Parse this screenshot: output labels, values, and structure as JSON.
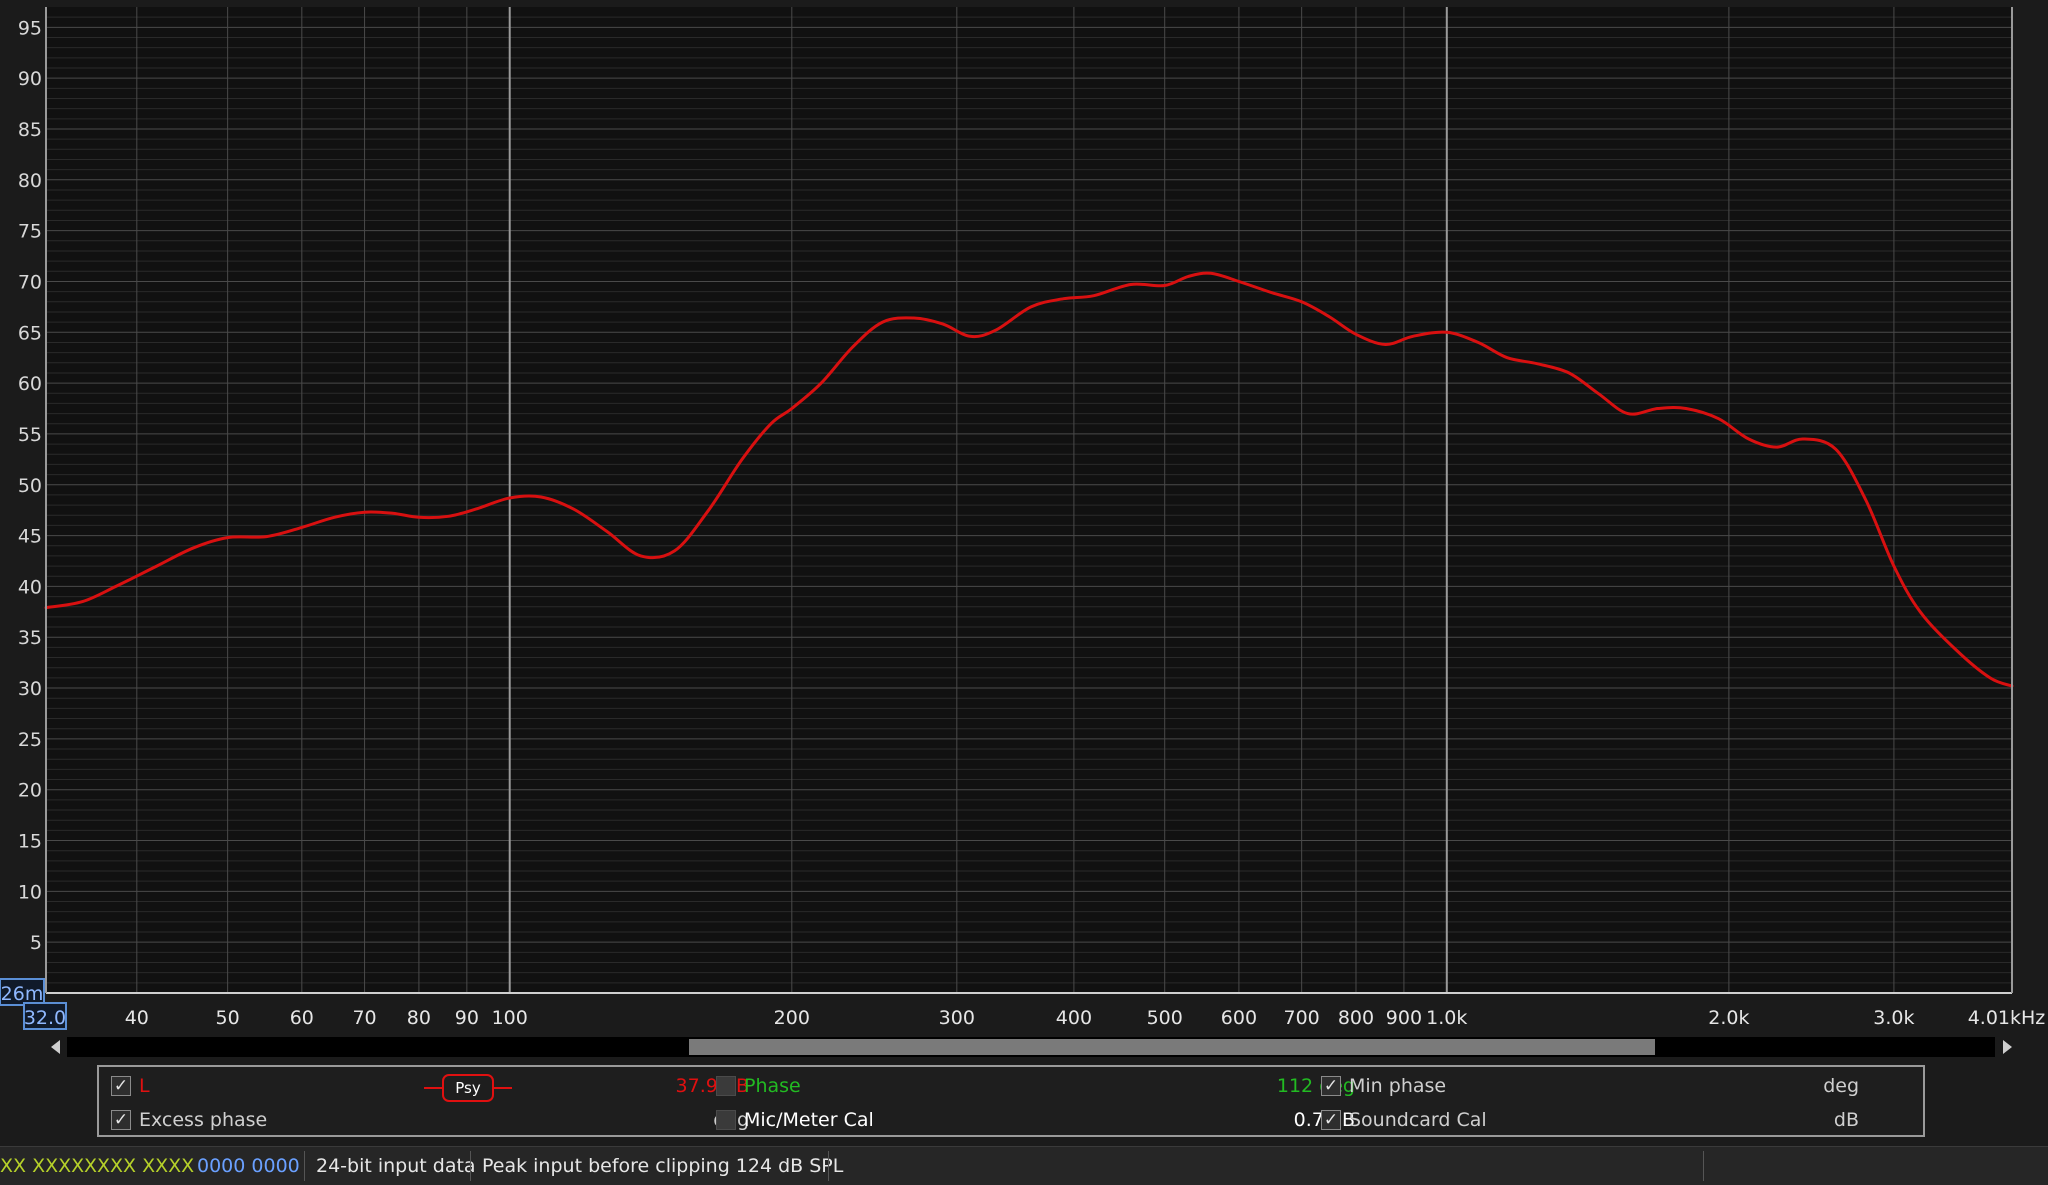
{
  "chart_data": {
    "type": "line",
    "x_scale": "log",
    "xlim": [
      32,
      4010
    ],
    "ylim": [
      0,
      97
    ],
    "x_unit": "kHz",
    "x_ticks": [
      {
        "v": 40,
        "label": "40"
      },
      {
        "v": 50,
        "label": "50"
      },
      {
        "v": 60,
        "label": "60"
      },
      {
        "v": 70,
        "label": "70"
      },
      {
        "v": 80,
        "label": "80"
      },
      {
        "v": 90,
        "label": "90"
      },
      {
        "v": 100,
        "label": "100"
      },
      {
        "v": 200,
        "label": "200"
      },
      {
        "v": 300,
        "label": "300"
      },
      {
        "v": 400,
        "label": "400"
      },
      {
        "v": 500,
        "label": "500"
      },
      {
        "v": 600,
        "label": "600"
      },
      {
        "v": 700,
        "label": "700"
      },
      {
        "v": 800,
        "label": "800"
      },
      {
        "v": 900,
        "label": "900"
      },
      {
        "v": 1000,
        "label": "1.0k"
      },
      {
        "v": 2000,
        "label": "2.0k"
      },
      {
        "v": 3000,
        "label": "3.0k"
      },
      {
        "v": 4010,
        "label": "4.01"
      }
    ],
    "x_start_label": "32.0",
    "y_ticks": [
      5,
      10,
      15,
      20,
      25,
      30,
      35,
      40,
      45,
      50,
      55,
      60,
      65,
      70,
      75,
      80,
      85,
      90,
      95
    ],
    "y_corner_label": "26m",
    "grid": true,
    "series": [
      {
        "name": "L",
        "color": "#d81010",
        "x": [
          32,
          35,
          38,
          42,
          46,
          50,
          55,
          60,
          65,
          70,
          75,
          80,
          86,
          92,
          100,
          108,
          117,
          127,
          138,
          150,
          163,
          177,
          190,
          200,
          215,
          232,
          250,
          270,
          290,
          310,
          330,
          360,
          390,
          420,
          460,
          500,
          530,
          560,
          600,
          650,
          700,
          750,
          800,
          860,
          920,
          1000,
          1080,
          1160,
          1250,
          1350,
          1450,
          1560,
          1680,
          1800,
          1950,
          2100,
          2250,
          2400,
          2600,
          2800,
          3000,
          3200,
          3500,
          3800,
          4010
        ],
        "values": [
          37.9,
          38.5,
          40.0,
          42.0,
          43.8,
          44.8,
          44.9,
          45.8,
          46.8,
          47.3,
          47.2,
          46.8,
          46.9,
          47.6,
          48.7,
          48.8,
          47.6,
          45.4,
          43.0,
          43.5,
          47.5,
          52.5,
          56.0,
          57.5,
          60.0,
          63.5,
          66.0,
          66.4,
          65.8,
          64.6,
          65.2,
          67.5,
          68.3,
          68.6,
          69.7,
          69.6,
          70.5,
          70.8,
          70.0,
          68.9,
          68.0,
          66.5,
          64.8,
          63.8,
          64.6,
          65.0,
          64.0,
          62.5,
          61.9,
          61.0,
          59.0,
          57.0,
          57.5,
          57.5,
          56.5,
          54.5,
          53.7,
          54.5,
          53.5,
          48.5,
          42.0,
          37.5,
          33.7,
          31.0,
          30.2
        ]
      }
    ]
  },
  "legend": {
    "row1": [
      {
        "label": "L",
        "checked": true,
        "color": "#e01010",
        "value": "37.9 dB",
        "value_color": "#e01010"
      },
      {
        "label": "Phase",
        "checked": false,
        "color": "#22bb22",
        "value": "112 deg",
        "value_color": "#22bb22"
      },
      {
        "label": "Min phase",
        "checked": true,
        "color": "#cfcfcf",
        "value": "deg",
        "value_color": "#cfcfcf"
      }
    ],
    "row2": [
      {
        "label": "Excess phase",
        "checked": true,
        "color": "#cfcfcf",
        "value": "deg",
        "value_color": "#cfcfcf"
      },
      {
        "label": "Mic/Meter Cal",
        "checked": false,
        "color": "#ffffff",
        "value": "0.7 dB",
        "value_color": "#ffffff"
      },
      {
        "label": "Soundcard Cal",
        "checked": true,
        "color": "#cfcfcf",
        "value": "dB",
        "value_color": "#cfcfcf"
      }
    ],
    "psy_label": "Psy",
    "check_glyph": "✓"
  },
  "status": {
    "meter_a": "XX XXXX",
    "meter_b": "XXXX XXXX",
    "meter_c": "0000 0000",
    "input_data": "24-bit input data",
    "peak": "Peak input before clipping 124 dB SPL",
    "meter_ab_color": "#b6d12a",
    "meter_c_color": "#6aa0ff"
  }
}
